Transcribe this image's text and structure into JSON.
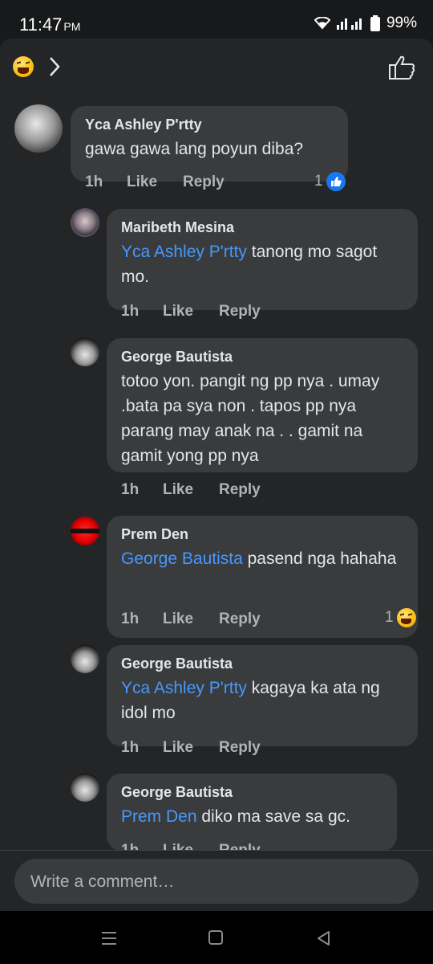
{
  "status": {
    "time": "11:47",
    "ampm": "PM",
    "battery": "99%"
  },
  "comments": [
    {
      "author": "Yca Ashley P'rtty",
      "mention": "",
      "text": "gawa gawa lang poyun diba?",
      "time": "1h",
      "like": "Like",
      "reply": "Reply",
      "reaction_count": "1"
    },
    {
      "author": "Maribeth Mesina",
      "mention": "Yca Ashley P'rtty",
      "text": " tanong mo sagot mo.",
      "time": "1h",
      "like": "Like",
      "reply": "Reply"
    },
    {
      "author": "George Bautista",
      "mention": "",
      "text": "totoo yon.  pangit ng pp nya . umay .bata pa sya non . tapos pp nya parang may anak na . . gamit na gamit yong pp nya",
      "time": "1h",
      "like": "Like",
      "reply": "Reply"
    },
    {
      "author": "Prem Den",
      "mention": "George Bautista",
      "text": " pasend nga hahaha",
      "time": "1h",
      "like": "Like",
      "reply": "Reply",
      "reaction_count": "1"
    },
    {
      "author": "George Bautista",
      "mention": "Yca Ashley P'rtty",
      "text": " kagaya ka ata ng idol mo",
      "time": "1h",
      "like": "Like",
      "reply": "Reply"
    },
    {
      "author": "George Bautista",
      "mention": "Prem Den",
      "text": " diko ma save sa gc.",
      "time": "1h",
      "like": "Like",
      "reply": "Reply"
    }
  ],
  "composer": {
    "placeholder": "Write a comment…"
  },
  "colors": {
    "background": "#242526",
    "bubble": "#3a3b3c",
    "mention": "#4599ff",
    "like_badge": "#1877f2",
    "haha": "#f7c21a"
  }
}
